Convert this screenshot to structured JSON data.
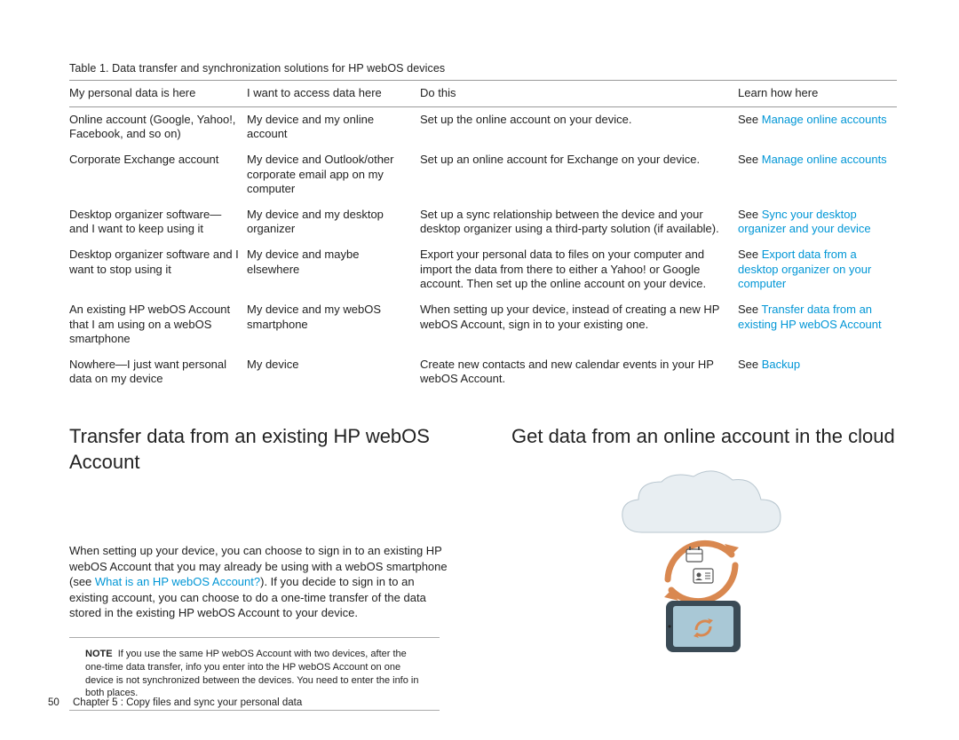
{
  "table": {
    "caption": "Table 1.  Data transfer and synchronization solutions for HP webOS devices",
    "headers": [
      "My personal data is here",
      "I want to access data here",
      "Do this",
      "Learn how here"
    ],
    "rows": [
      {
        "c1": "Online account (Google, Yahoo!, Facebook, and so on)",
        "c2": "My device and my online account",
        "c3": "Set up the online account on your device.",
        "c4pre": "See ",
        "c4link": "Manage online accounts"
      },
      {
        "c1": "Corporate Exchange account",
        "c2": "My device and Outlook/other corporate email app on my computer",
        "c3": "Set up an online account for Exchange on your device.",
        "c4pre": "See ",
        "c4link": "Manage online accounts"
      },
      {
        "c1": "Desktop organizer software—and I want to keep using it",
        "c2": "My device and my desktop organizer",
        "c3": "Set up a sync relationship between the device and your desktop organizer using a third-party solution (if available).",
        "c4pre": "See ",
        "c4link": "Sync your desktop organizer and your device"
      },
      {
        "c1": "Desktop organizer software and I want to stop using it",
        "c2": "My device and maybe elsewhere",
        "c3": "Export your personal data to files on your computer and import the data from there to either a Yahoo! or Google account. Then set up the online account on your device.",
        "c4pre": "See ",
        "c4link": "Export data from a desktop organizer on your computer"
      },
      {
        "c1": "An existing HP webOS Account that I am using on a webOS smartphone",
        "c2": "My device and my webOS smartphone",
        "c3": "When setting up your device, instead of creating a new HP webOS Account, sign in to your existing one.",
        "c4pre": "See ",
        "c4link": "Transfer data from an existing HP webOS Account"
      },
      {
        "c1": "Nowhere—I just want personal data on my device",
        "c2": "My device",
        "c3": "Create new contacts and new calendar events in your HP webOS Account.",
        "c4pre": "See ",
        "c4link": "Backup"
      }
    ]
  },
  "left": {
    "heading": "Transfer data from an existing HP webOS Account",
    "para_a": "When setting up your device, you can choose to sign in to an existing HP webOS Account that you may already be using with a webOS smartphone (see ",
    "para_link": "What is an HP webOS Account?",
    "para_b": "). If you decide to sign in to an existing account, you can choose to do a one-time transfer of the data stored in the existing HP webOS Account to your device.",
    "note_label": "NOTE",
    "note_body": "If you use the same HP webOS Account with two devices, after the one-time data transfer, info you enter into the HP webOS Account on one device is not synchronized between the devices. You need to enter the info in both places."
  },
  "right": {
    "heading": "Get data from an online account in the cloud"
  },
  "footer": {
    "page": "50",
    "chapter": "Chapter 5 : Copy files and sync your personal data"
  }
}
